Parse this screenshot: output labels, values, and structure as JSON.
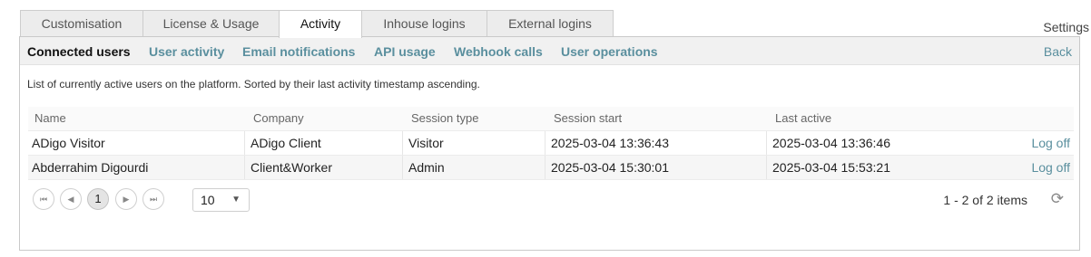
{
  "tabs": [
    {
      "label": "Customisation"
    },
    {
      "label": "License & Usage"
    },
    {
      "label": "Activity"
    },
    {
      "label": "Inhouse logins"
    },
    {
      "label": "External logins"
    }
  ],
  "settings_label": "Settings",
  "subnav": {
    "items": [
      {
        "label": "Connected users"
      },
      {
        "label": "User activity"
      },
      {
        "label": "Email notifications"
      },
      {
        "label": "API usage"
      },
      {
        "label": "Webhook calls"
      },
      {
        "label": "User operations"
      }
    ],
    "back_label": "Back"
  },
  "description": "List of currently active users on the platform. Sorted by their last activity timestamp ascending.",
  "table": {
    "columns": [
      "Name",
      "Company",
      "Session type",
      "Session start",
      "Last active"
    ],
    "rows": [
      {
        "name": "ADigo Visitor",
        "company": "ADigo Client",
        "session_type": "Visitor",
        "session_start": "2025-03-04 13:36:43",
        "last_active": "2025-03-04 13:36:46",
        "action": "Log off"
      },
      {
        "name": "Abderrahim Digourdi",
        "company": "Client&Worker",
        "session_type": "Admin",
        "session_start": "2025-03-04 15:30:01",
        "last_active": "2025-03-04 15:53:21",
        "action": "Log off"
      }
    ]
  },
  "pager": {
    "first_icon": "first-page-icon",
    "prev_icon": "prev-page-icon",
    "current_page": "1",
    "next_icon": "next-page-icon",
    "last_icon": "last-page-icon",
    "page_size": "10",
    "info": "1 - 2 of 2 items",
    "refresh_icon": "refresh-icon"
  }
}
